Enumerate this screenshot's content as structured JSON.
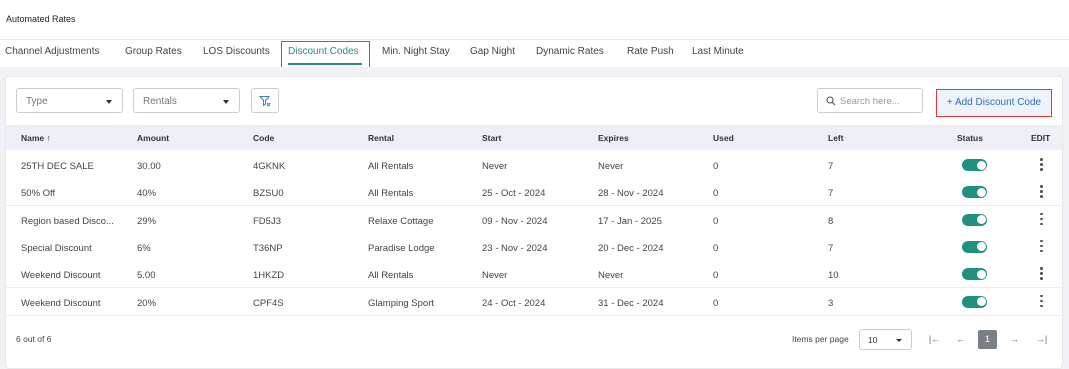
{
  "page_title": "Automated Rates",
  "tabs": [
    {
      "label": "Channel Adjustments"
    },
    {
      "label": "Group Rates"
    },
    {
      "label": "LOS Discounts"
    },
    {
      "label": "Discount Codes"
    },
    {
      "label": "Min. Night Stay"
    },
    {
      "label": "Gap Night"
    },
    {
      "label": "Dynamic Rates"
    },
    {
      "label": "Rate Push"
    },
    {
      "label": "Last Minute"
    }
  ],
  "active_tab": "Discount Codes",
  "filters": {
    "type_label": "Type",
    "rentals_label": "Rentals",
    "search_placeholder": "Search here..."
  },
  "add_button_label": "+ Add Discount Code",
  "columns": [
    "Name",
    "Amount",
    "Code",
    "Rental",
    "Start",
    "Expires",
    "Used",
    "Left",
    "Status",
    "EDIT"
  ],
  "sort_indicator": "↑",
  "rows": [
    {
      "name": "25TH DEC SALE",
      "amount": "30.00",
      "code": "4GKNK",
      "rental": "All Rentals",
      "start": "Never",
      "expires": "Never",
      "used": "0",
      "left": "7",
      "status": "on"
    },
    {
      "name": "50% Off",
      "amount": "40%",
      "code": "BZSU0",
      "rental": "All Rentals",
      "start": "25 - Oct - 2024",
      "expires": "28 - Nov - 2024",
      "used": "0",
      "left": "7",
      "status": "on"
    },
    {
      "name": "Region based Disco...",
      "amount": "29%",
      "code": "FD5J3",
      "rental": "Relaxe Cottage",
      "start": "09 - Nov - 2024",
      "expires": "17 - Jan - 2025",
      "used": "0",
      "left": "8",
      "status": "on"
    },
    {
      "name": "Special Discount",
      "amount": "6%",
      "code": "T36NP",
      "rental": "Paradise Lodge",
      "start": "23 - Nov - 2024",
      "expires": "20 - Dec - 2024",
      "used": "0",
      "left": "7",
      "status": "on"
    },
    {
      "name": "Weekend Discount",
      "amount": "5.00",
      "code": "1HKZD",
      "rental": "All Rentals",
      "start": "Never",
      "expires": "Never",
      "used": "0",
      "left": "10",
      "status": "on"
    },
    {
      "name": "Weekend Discount",
      "amount": "20%",
      "code": "CPF4S",
      "rental": "Glamping Sport",
      "start": "24 - Oct - 2024",
      "expires": "31 - Dec - 2024",
      "used": "0",
      "left": "3",
      "status": "on"
    }
  ],
  "footer": {
    "count_text": "6 out of 6",
    "items_per_page_label": "Items per page",
    "items_per_page_value": "10",
    "current_page": "1",
    "first_glyph": "|←",
    "prev_glyph": "←",
    "next_glyph": "→",
    "last_glyph": "→|"
  },
  "colors": {
    "accent": "#2a8c87",
    "toggle_on": "#21907e",
    "highlight_border": "#e0393e",
    "link_blue": "#2f6fbf"
  }
}
